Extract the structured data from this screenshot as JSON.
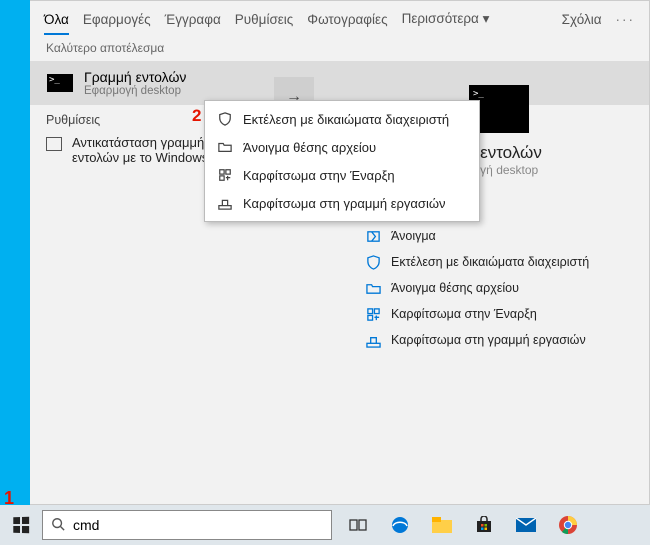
{
  "tabs": {
    "all": "Όλα",
    "apps": "Εφαρμογές",
    "docs": "Έγγραφα",
    "settings": "Ρυθμίσεις",
    "photos": "Φωτογραφίες",
    "more": "Περισσότερα ▾",
    "comments": "Σχόλια",
    "dots": "···"
  },
  "sections": {
    "best": "Καλύτερο αποτέλεσμα",
    "settings": "Ρυθμίσεις"
  },
  "result": {
    "title": "Γραμμή εντολών",
    "subtitle": "Εφαρμογή desktop"
  },
  "settingsItem": "Αντικατάσταση γραμμής εντολών με το Windows",
  "detail": {
    "title": "Γραμμή εντολών",
    "subtitle": "Εφαρμογή desktop",
    "title_partial": "μή εντολών",
    "subtitle_partial": "ρμογή desktop"
  },
  "actions": {
    "open": "Άνοιγμα",
    "admin": "Εκτέλεση με δικαιώματα διαχειριστή",
    "location": "Άνοιγμα θέσης αρχείου",
    "pinstart": "Καρφίτσωμα στην Έναρξη",
    "pintask": "Καρφίτσωμα στη γραμμή εργασιών"
  },
  "context": {
    "admin": "Εκτέλεση με δικαιώματα διαχειριστή",
    "location": "Άνοιγμα θέσης αρχείου",
    "pinstart": "Καρφίτσωμα στην Έναρξη",
    "pintask": "Καρφίτσωμα στη γραμμή εργασιών"
  },
  "markers": {
    "one": "1",
    "two": "2"
  },
  "glyphs": {
    "cmd": ">_",
    "chevron": "→"
  },
  "search": {
    "value": "cmd"
  }
}
